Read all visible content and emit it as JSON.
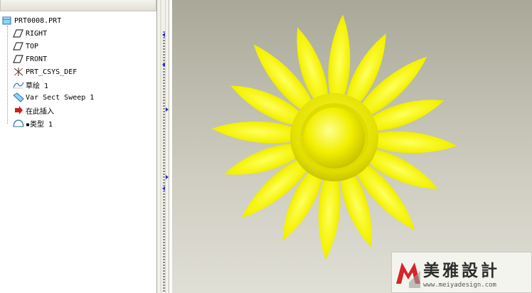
{
  "tree": {
    "root": "PRT0008.PRT",
    "items": [
      {
        "label": "RIGHT",
        "icon": "datum-plane-icon"
      },
      {
        "label": "TOP",
        "icon": "datum-plane-icon"
      },
      {
        "label": "FRONT",
        "icon": "datum-plane-icon"
      },
      {
        "label": "PRT_CSYS_DEF",
        "icon": "coordinate-system-icon"
      },
      {
        "label": "草绘 1",
        "icon": "sketch-icon"
      },
      {
        "label": "Var Sect Sweep 1",
        "icon": "sweep-icon"
      },
      {
        "label": "在此插入",
        "icon": "insert-here-arrow-icon"
      },
      {
        "label": "▪类型 1",
        "icon": "surface-feature-icon"
      }
    ]
  },
  "model": {
    "name": "yellow-flower-part",
    "petal_count": 16,
    "color": "#f2f000",
    "background_top": "#a9a898",
    "background_bottom": "#e0dfd6"
  },
  "watermark": {
    "brand": "美雅設計",
    "url": "www.meiyadesign.com",
    "accent_color": "#d4262a"
  }
}
